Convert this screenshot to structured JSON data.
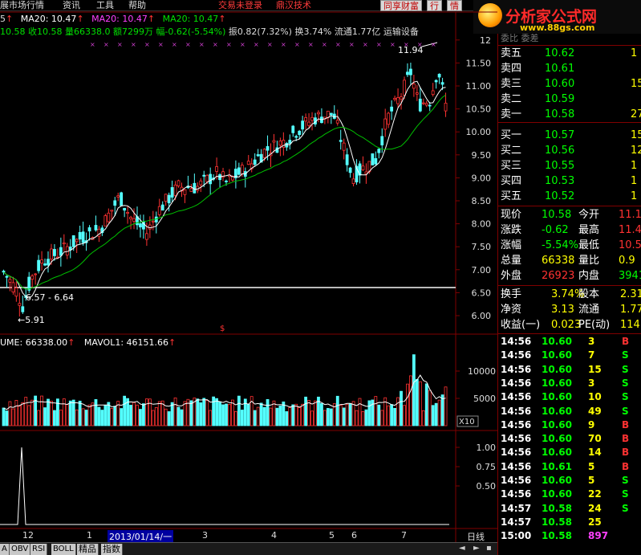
{
  "menubar": {
    "items": [
      "展市场行情",
      "资讯",
      "工具",
      "帮助"
    ],
    "trade_status": "交易未登录",
    "brand": "鼎汉技术",
    "buttons": [
      "同享财富",
      "行",
      "情"
    ]
  },
  "logo": {
    "name": "分析家公式网",
    "url": "www.88gs.com"
  },
  "ma_line": {
    "prefix": "5",
    "ma1": "MA20: 10.47",
    "ma2": "MA20: 10.47",
    "ma3": "MA20: 10.47"
  },
  "info_line": {
    "price_part": "10.58 收10.58 量66338.0 额7299万",
    "change_part": "幅-0.62(-5.54%)",
    "rest_part": "振0.82(7.32%) 换3.74% 流通1.77亿 运输设备"
  },
  "kline": {
    "y_ticks": [
      "12",
      "11.50",
      "11.00",
      "10.50",
      "10.00",
      "9.50",
      "9.00",
      "8.50",
      "8.00",
      "7.50",
      "7.00",
      "6.50",
      "6.00"
    ],
    "high_label": "11.94",
    "low_label": "5.91",
    "range_label": "6.57 - 6.64"
  },
  "volume": {
    "header_vol": "UME: 66338.00",
    "header_mavol": "MAVOL1: 46151.66",
    "y_ticks": [
      "10000",
      "5000"
    ],
    "unit": "X10"
  },
  "indicator": {
    "y_ticks": [
      "1.00",
      "0.75",
      "0.50"
    ]
  },
  "xaxis": {
    "labels": [
      "12",
      "1",
      "3",
      "4",
      "5",
      "6",
      "7"
    ],
    "cursor_date": "2013/01/14/一",
    "period": "日线"
  },
  "tabs": [
    "A",
    "OBV",
    "RSI",
    "BOLL",
    "精品",
    "指数"
  ],
  "orderbook": {
    "header_partial": "委比      委差",
    "sells": [
      {
        "label": "卖五",
        "price": "10.62",
        "vol": "1"
      },
      {
        "label": "卖四",
        "price": "10.61",
        "vol": ""
      },
      {
        "label": "卖三",
        "price": "10.60",
        "vol": "15"
      },
      {
        "label": "卖二",
        "price": "10.59",
        "vol": ""
      },
      {
        "label": "卖一",
        "price": "10.58",
        "vol": "27"
      }
    ],
    "buys": [
      {
        "label": "买一",
        "price": "10.57",
        "vol": "15"
      },
      {
        "label": "买二",
        "price": "10.56",
        "vol": "12"
      },
      {
        "label": "买三",
        "price": "10.55",
        "vol": "1"
      },
      {
        "label": "买四",
        "price": "10.53",
        "vol": "1"
      },
      {
        "label": "买五",
        "price": "10.52",
        "vol": "1"
      }
    ]
  },
  "quote": [
    {
      "l1": "现价",
      "v1": "10.58",
      "l2": "今开",
      "v2": "11.1"
    },
    {
      "l1": "涨跌",
      "v1": "-0.62",
      "l2": "最高",
      "v2": "11.4"
    },
    {
      "l1": "涨幅",
      "v1": "-5.54%",
      "l2": "最低",
      "v2": "10.5"
    },
    {
      "l1": "总量",
      "v1": "66338",
      "l2": "量比",
      "v2": "0.9"
    },
    {
      "l1": "外盘",
      "v1": "26923",
      "l2": "内盘",
      "v2": "3941"
    }
  ],
  "fund": [
    {
      "l1": "换手",
      "v1": "3.74%",
      "l2": "股本",
      "v2": "2.31"
    },
    {
      "l1": "净资",
      "v1": "3.13",
      "l2": "流通",
      "v2": "1.77"
    },
    {
      "l1": "收益(一)",
      "v1": "0.023",
      "l2": "PE(动)",
      "v2": "114"
    }
  ],
  "trades": [
    {
      "time": "14:56",
      "price": "10.60",
      "vol": "3",
      "side": "B"
    },
    {
      "time": "14:56",
      "price": "10.60",
      "vol": "7",
      "side": "S"
    },
    {
      "time": "14:56",
      "price": "10.60",
      "vol": "15",
      "side": "S"
    },
    {
      "time": "14:56",
      "price": "10.60",
      "vol": "3",
      "side": "S"
    },
    {
      "time": "14:56",
      "price": "10.60",
      "vol": "10",
      "side": "S"
    },
    {
      "time": "14:56",
      "price": "10.60",
      "vol": "49",
      "side": "S"
    },
    {
      "time": "14:56",
      "price": "10.60",
      "vol": "9",
      "side": "B"
    },
    {
      "time": "14:56",
      "price": "10.60",
      "vol": "70",
      "side": "B"
    },
    {
      "time": "14:56",
      "price": "10.60",
      "vol": "14",
      "side": "B"
    },
    {
      "time": "14:56",
      "price": "10.61",
      "vol": "5",
      "side": "B"
    },
    {
      "time": "14:56",
      "price": "10.60",
      "vol": "5",
      "side": "S"
    },
    {
      "time": "14:56",
      "price": "10.60",
      "vol": "22",
      "side": "S"
    },
    {
      "time": "14:57",
      "price": "10.58",
      "vol": "24",
      "side": "S"
    },
    {
      "time": "14:57",
      "price": "10.58",
      "vol": "25",
      "side": ""
    },
    {
      "time": "15:00",
      "price": "10.58",
      "vol": "897",
      "side": ""
    }
  ],
  "colors": {
    "up": "#ff3232",
    "down": "#54ffff",
    "ma_white": "#ffffff",
    "ma_green": "#00c000",
    "frame": "#800000",
    "yellow": "#ffff00"
  }
}
